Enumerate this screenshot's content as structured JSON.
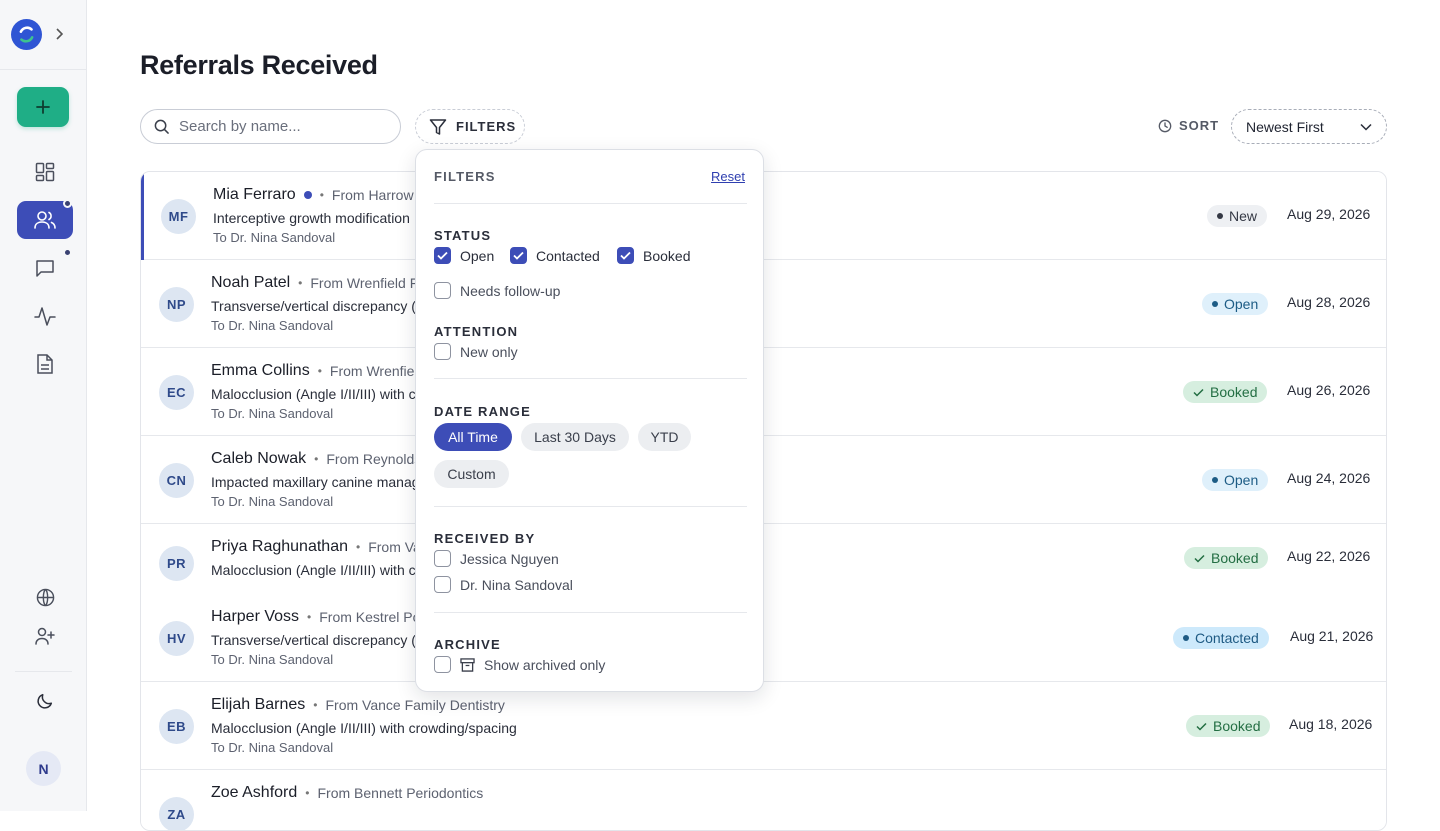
{
  "page": {
    "title": "Referrals Received"
  },
  "toolbar": {
    "search_placeholder": "Search by name...",
    "filters_label": "FILTERS",
    "sort_label": "SORT",
    "sort_value": "Newest First"
  },
  "colors": {
    "accent": "#3d4db7",
    "add_button": "#1fae86"
  },
  "sidebar": {
    "icons": [
      "app-logo-icon",
      "expand-icon",
      "plus-icon",
      "dashboard-icon",
      "users-icon",
      "message-icon",
      "activity-icon",
      "document-icon",
      "globe-icon",
      "add-user-icon",
      "moon-icon"
    ],
    "avatar_initial": "N"
  },
  "rows": [
    {
      "initials": "MF",
      "name": "Mia Ferraro",
      "from": "From Harrow",
      "desc": "Interceptive growth modification",
      "to": "To Dr. Nina Sandoval",
      "status": "New",
      "date": "Aug 29, 2026",
      "unread": true
    },
    {
      "initials": "NP",
      "name": "Noah Patel",
      "from": "From Wrenfield F",
      "desc": "Transverse/vertical discrepancy (",
      "to": "To Dr. Nina Sandoval",
      "status": "Open",
      "date": "Aug 28, 2026",
      "unread": false
    },
    {
      "initials": "EC",
      "name": "Emma Collins",
      "from": "From Wrenfiel",
      "desc": "Malocclusion (Angle I/II/III) with c",
      "to": "To Dr. Nina Sandoval",
      "status": "Booked",
      "date": "Aug 26, 2026",
      "unread": false
    },
    {
      "initials": "CN",
      "name": "Caleb Nowak",
      "from": "From Reynolds",
      "desc": "Impacted maxillary canine manag",
      "to": "To Dr. Nina Sandoval",
      "status": "Open",
      "date": "Aug 24, 2026",
      "unread": false
    },
    {
      "initials": "PR",
      "name": "Priya Raghunathan",
      "from": "From Va",
      "desc": "Malocclusion (Angle I/II/III) with c",
      "to": "",
      "status": "Booked",
      "date": "Aug 22, 2026",
      "unread": false
    },
    {
      "initials": "HV",
      "name": "Harper Voss",
      "from": "From Kestrel Po",
      "desc": "Transverse/vertical discrepancy (",
      "to": "To Dr. Nina Sandoval",
      "status": "Contacted",
      "date": "Aug 21, 2026",
      "unread": false
    },
    {
      "initials": "EB",
      "name": "Elijah Barnes",
      "from": "From Vance Family Dentistry",
      "desc": "Malocclusion (Angle I/II/III) with crowding/spacing",
      "to": "To Dr. Nina Sandoval",
      "status": "Booked",
      "date": "Aug 18, 2026",
      "unread": false
    },
    {
      "initials": "ZA",
      "name": "Zoe Ashford",
      "from": "From Bennett Periodontics",
      "desc": "",
      "to": "",
      "status": "",
      "date": "",
      "unread": false
    }
  ],
  "filters": {
    "title": "FILTERS",
    "reset": "Reset",
    "status": {
      "label": "STATUS",
      "options": [
        {
          "label": "Open",
          "checked": true
        },
        {
          "label": "Contacted",
          "checked": true
        },
        {
          "label": "Booked",
          "checked": true
        },
        {
          "label": "Needs follow-up",
          "checked": false
        }
      ]
    },
    "attention": {
      "label": "ATTENTION",
      "options": [
        {
          "label": "New only",
          "checked": false
        }
      ]
    },
    "date_range": {
      "label": "DATE RANGE",
      "chips": [
        {
          "label": "All Time",
          "selected": true
        },
        {
          "label": "Last 30 Days",
          "selected": false
        },
        {
          "label": "YTD",
          "selected": false
        },
        {
          "label": "Custom",
          "selected": false
        }
      ]
    },
    "received_by": {
      "label": "RECEIVED BY",
      "options": [
        {
          "label": "Jessica Nguyen",
          "checked": false
        },
        {
          "label": "Dr. Nina Sandoval",
          "checked": false
        }
      ]
    },
    "archive": {
      "label": "ARCHIVE",
      "options": [
        {
          "label": "Show archived only",
          "checked": false
        }
      ]
    }
  }
}
